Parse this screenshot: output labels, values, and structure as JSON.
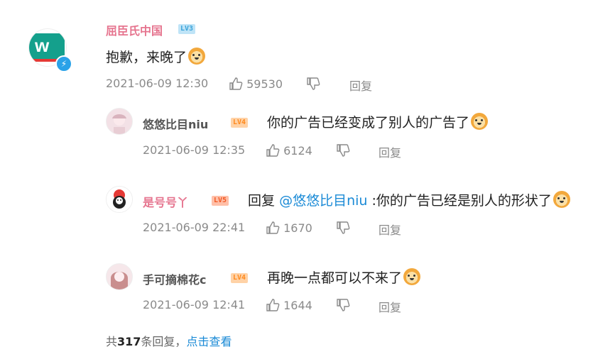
{
  "main_comment": {
    "author": "屈臣氏中国",
    "level": "LV3",
    "text": "抱歉，来晚了",
    "time": "2021-06-09 12:30",
    "likes": "59530",
    "reply_label": "回复"
  },
  "replies": [
    {
      "author": "悠悠比目niu",
      "level": "LV4",
      "text": "你的广告已经变成了别人的广告了",
      "time": "2021-06-09 12:35",
      "likes": "6124",
      "reply_label": "回复"
    },
    {
      "author": "是号号丫",
      "level": "LV5",
      "reply_prefix": "回复",
      "mention": "@悠悠比目niu",
      "text": ":你的广告已经是别人的形状了",
      "time": "2021-06-09 22:41",
      "likes": "1670",
      "reply_label": "回复"
    },
    {
      "author": "手可摘棉花c",
      "level": "LV4",
      "text": "再晚一点都可以不来了",
      "time": "2021-06-09 12:41",
      "likes": "1644",
      "reply_label": "回复"
    }
  ],
  "footer": {
    "prefix": "共",
    "count": "317",
    "suffix": "条回复，",
    "link": "点击查看"
  },
  "colors": {
    "name_pink": "#e6758f",
    "link_blue": "#1a8ad6",
    "meta_gray": "#8a8a8a"
  },
  "icons": {
    "like": "thumbs-up-icon",
    "dislike": "thumbs-down-icon",
    "emoji": "doge-emoji-icon",
    "verified": "verified-lightning-icon"
  }
}
